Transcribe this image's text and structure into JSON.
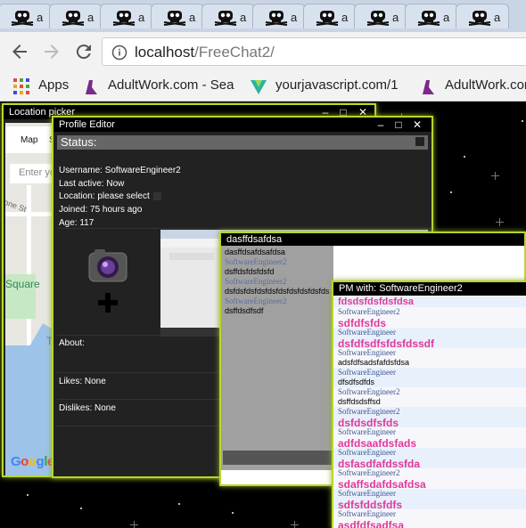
{
  "tabs": [
    {
      "label": "a"
    },
    {
      "label": "a"
    },
    {
      "label": "a"
    },
    {
      "label": "a"
    },
    {
      "label": "a"
    },
    {
      "label": "a"
    },
    {
      "label": "a"
    },
    {
      "label": "a"
    },
    {
      "label": "a"
    },
    {
      "label": "a"
    }
  ],
  "toolbar": {
    "url_host": "localhost",
    "url_path": "/FreeChat2/"
  },
  "bookmarks": [
    {
      "label": "Apps",
      "icon": "apps-grid-icon"
    },
    {
      "label": "AdultWork.com - Sea",
      "icon": "adultwork-icon"
    },
    {
      "label": "yourjavascript.com/1",
      "icon": "yourjavascript-icon"
    },
    {
      "label": "AdultWork.com",
      "icon": "adultwork-icon"
    }
  ],
  "location_picker": {
    "title": "Location picker",
    "map_tabs": [
      "Map",
      "S"
    ],
    "search_placeholder": "Enter yo",
    "street": "one St",
    "poi": "Square",
    "poi2": "Th",
    "google": "Google"
  },
  "profile": {
    "title": "Profile Editor",
    "status_label": "Status:",
    "username": "Username: SoftwareEngineer2",
    "last_active": "Last active: Now",
    "location": "Location: please select",
    "joined": "Joined: 75 hours ago",
    "age": "Age: 117",
    "about": "About:",
    "likes": "Likes: None",
    "dislikes": "Dislikes: None"
  },
  "chat": {
    "title": "dasffdsafdsa",
    "messages": [
      {
        "user": "",
        "text": "dasffdsafdsafdsa"
      },
      {
        "user": "SoftwareEngineer2",
        "text": "dsffdsfdsfdsfd"
      },
      {
        "user": "SoftwareEngineer2",
        "text": "dsfdsfdsfdsfdsfdsfdsfdsfdsfds"
      },
      {
        "user": "SoftwareEngineer2",
        "text": "dsffdsdfsdf"
      }
    ]
  },
  "pm": {
    "title": "PM with: SoftwareEngineer2",
    "messages": [
      {
        "user": "",
        "text": "fdsdsfdsfdsfdsa",
        "size": 11
      },
      {
        "user": "SoftwareEngineer2",
        "text": "sdfdfsfds",
        "size": 12
      },
      {
        "user": "SoftwareEngineer",
        "text": "dsfdfsdfsfdsfdssdf",
        "size": 12
      },
      {
        "user": "SoftwareEngineer",
        "text": "adsfdfsadsfafdsfdsa",
        "size": 9,
        "plain": true
      },
      {
        "user": "SoftwareEngineer",
        "text": "dfsdfsdfds",
        "size": 9,
        "plain": true
      },
      {
        "user": "SoftwareEngineer2",
        "text": "dsffdsdsffsd",
        "size": 9,
        "plain": true
      },
      {
        "user": "SoftwareEngineer2",
        "text": "dsfdsdfsfds",
        "size": 12
      },
      {
        "user": "SoftwareEngineer",
        "text": "adfdsaafdsfads",
        "size": 12
      },
      {
        "user": "SoftwareEngineer",
        "text": "dsfasdfafdssfda",
        "size": 12
      },
      {
        "user": "SoftwareEngineer2",
        "text": "sdaffsdafdsafdsa",
        "size": 12
      },
      {
        "user": "SoftwareEngineer",
        "text": "sdfsfddsfdfs",
        "size": 12
      },
      {
        "user": "SoftwareEngineer",
        "text": "asdfdfsadfsa",
        "size": 12
      },
      {
        "user": "SoftwareEngineer2",
        "text": "",
        "size": 12
      }
    ]
  },
  "colors": {
    "window_border": "#b7d62e",
    "pm_text": "#e0399a",
    "username_text": "#3e568f"
  }
}
